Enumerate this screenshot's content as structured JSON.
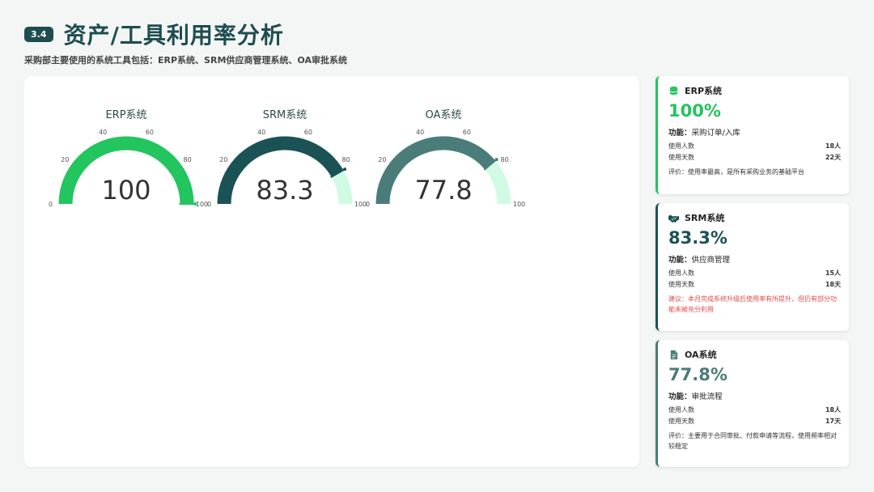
{
  "header": {
    "section_no": "3.4",
    "title": "资产/工具利用率分析",
    "subtitle": "采购部主要使用的系统工具包括：ERP系统、SRM供应商管理系统、OA审批系统"
  },
  "colors": {
    "erp": "#22c55e",
    "srm": "#1a5256",
    "oa": "#4a7c7a",
    "track": "#d1fae5",
    "warn": "#e34b4b"
  },
  "chart_data": {
    "type": "gauge",
    "gauges": [
      {
        "title": "ERP系统",
        "value": 100,
        "display": "100",
        "min": 0,
        "max": 100,
        "ticks": [
          "0",
          "20",
          "40",
          "60",
          "80",
          "100"
        ],
        "color": "#22c55e"
      },
      {
        "title": "SRM系统",
        "value": 83.3,
        "display": "83.3",
        "min": 0,
        "max": 100,
        "ticks": [
          "0",
          "20",
          "40",
          "60",
          "80",
          "100"
        ],
        "color": "#1a5256"
      },
      {
        "title": "OA系统",
        "value": 77.8,
        "display": "77.8",
        "min": 0,
        "max": 100,
        "ticks": [
          "0",
          "20",
          "40",
          "60",
          "80",
          "100"
        ],
        "color": "#4a7c7a"
      }
    ]
  },
  "cards": [
    {
      "icon": "database-icon",
      "name": "ERP系统",
      "pct": "100%",
      "func_label": "功能：",
      "func_value": "采购订单/入库",
      "users_label": "使用人数",
      "users_value": "18人",
      "days_label": "使用天数",
      "days_value": "22天",
      "note": "评价：使用率最高，是所有采购业务的基础平台"
    },
    {
      "icon": "handshake-icon",
      "name": "SRM系统",
      "pct": "83.3%",
      "func_label": "功能：",
      "func_value": "供应商管理",
      "users_label": "使用人数",
      "users_value": "15人",
      "days_label": "使用天数",
      "days_value": "18天",
      "note": "建议：本月完成系统升级后使用率有所提升，但仍有部分功能未被充分利用"
    },
    {
      "icon": "document-icon",
      "name": "OA系统",
      "pct": "77.8%",
      "func_label": "功能：",
      "func_value": "审批流程",
      "users_label": "使用人数",
      "users_value": "18人",
      "days_label": "使用天数",
      "days_value": "17天",
      "note": "评价：主要用于合同审批、付款申请等流程，使用频率相对较稳定"
    }
  ]
}
